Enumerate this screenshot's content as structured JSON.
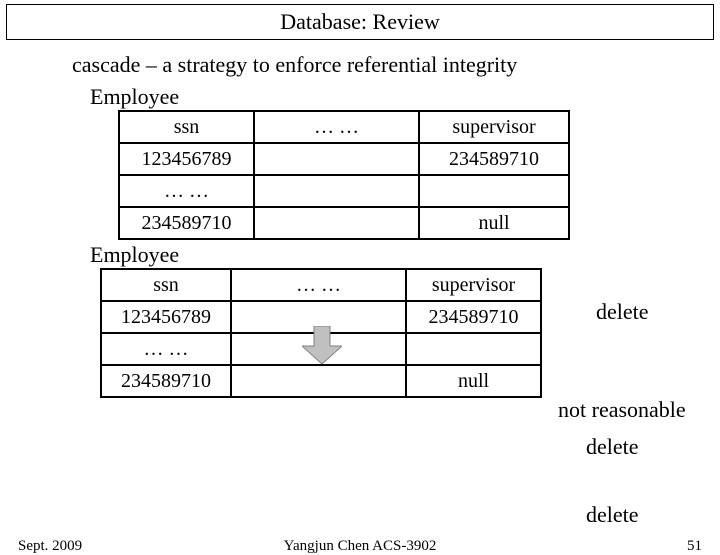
{
  "header": {
    "title": "Database: Review"
  },
  "body": {
    "text": "cascade – a strategy to enforce referential integrity"
  },
  "table1": {
    "label": "Employee",
    "headers": {
      "c1": "ssn",
      "c2": "… …",
      "c3": "supervisor"
    },
    "rows": [
      {
        "c1": "123456789",
        "c2": "",
        "c3": "234589710"
      },
      {
        "c1": "… …",
        "c2": "",
        "c3": ""
      },
      {
        "c1": "234589710",
        "c2": "",
        "c3": "null"
      }
    ],
    "annot_delete": "delete"
  },
  "table2": {
    "label": "Employee",
    "headers": {
      "c1": "ssn",
      "c2": "… …",
      "c3": "supervisor"
    },
    "rows": [
      {
        "c1": "123456789",
        "c2": "",
        "c3": "234589710"
      },
      {
        "c1": "… …",
        "c2": "",
        "c3": ""
      },
      {
        "c1": "234589710",
        "c2": "",
        "c3": "null"
      }
    ],
    "annot_not_reasonable": "not reasonable",
    "annot_delete1": "delete",
    "annot_delete2": "delete"
  },
  "footer": {
    "left": "Sept. 2009",
    "center": "Yangjun Chen      ACS-3902",
    "right": "51"
  }
}
